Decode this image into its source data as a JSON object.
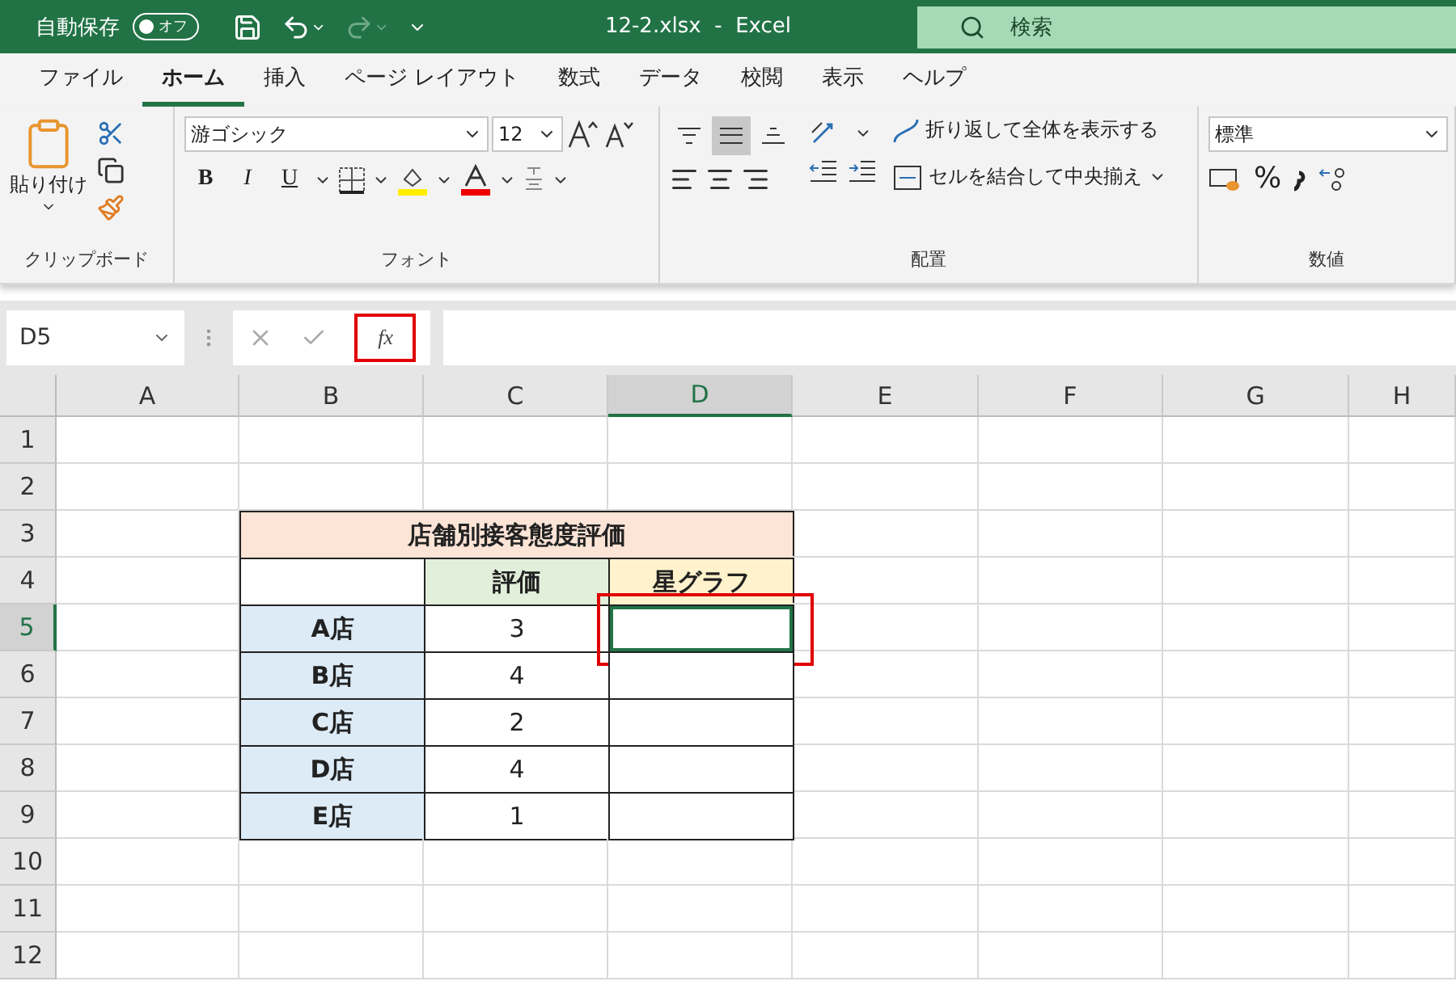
{
  "title_bar": {
    "autosave_label": "自動保存",
    "autosave_toggle": {
      "on": false,
      "label": "オフ"
    },
    "title": "12-2.xlsx  -  Excel",
    "search": {
      "placeholder": "検索"
    }
  },
  "tabs": [
    {
      "label": "ファイル",
      "selected": false
    },
    {
      "label": "ホーム",
      "selected": true
    },
    {
      "label": "挿入",
      "selected": false
    },
    {
      "label": "ページ レイアウト",
      "selected": false
    },
    {
      "label": "数式",
      "selected": false
    },
    {
      "label": "データ",
      "selected": false
    },
    {
      "label": "校閲",
      "selected": false
    },
    {
      "label": "表示",
      "selected": false
    },
    {
      "label": "ヘルプ",
      "selected": false
    }
  ],
  "ribbon": {
    "clipboard": {
      "paste_label": "貼り付け",
      "group_label": "クリップボード"
    },
    "font": {
      "font_name": "游ゴシック",
      "font_size": "12",
      "bold": "B",
      "italic": "I",
      "underline": "U",
      "group_label": "フォント"
    },
    "alignment": {
      "vertical_align": [
        {
          "selected": false
        },
        {
          "selected": true
        },
        {
          "selected": false
        }
      ],
      "wrap_text": "折り返して全体を表示する",
      "merge_center": "セルを結合して中央揃え",
      "group_label": "配置"
    },
    "number": {
      "format": "標準",
      "percent": "%",
      "group_label": "数値"
    }
  },
  "formula_bar": {
    "name_box": "D5",
    "function_label": "fx",
    "function_highlighted": true
  },
  "sheet": {
    "columns": [
      {
        "label": "A",
        "selected": false
      },
      {
        "label": "B",
        "selected": false
      },
      {
        "label": "C",
        "selected": false
      },
      {
        "label": "D",
        "selected": true
      },
      {
        "label": "E",
        "selected": false
      },
      {
        "label": "F",
        "selected": false
      },
      {
        "label": "G",
        "selected": false
      },
      {
        "label": "H",
        "selected": false
      }
    ],
    "rows": [
      {
        "label": "1",
        "selected": false
      },
      {
        "label": "2",
        "selected": false
      },
      {
        "label": "3",
        "selected": false
      },
      {
        "label": "4",
        "selected": false
      },
      {
        "label": "5",
        "selected": true
      },
      {
        "label": "6",
        "selected": false
      },
      {
        "label": "7",
        "selected": false
      },
      {
        "label": "8",
        "selected": false
      },
      {
        "label": "9",
        "selected": false
      },
      {
        "label": "10",
        "selected": false
      },
      {
        "label": "11",
        "selected": false
      },
      {
        "label": "12",
        "selected": false
      }
    ],
    "table": {
      "title": {
        "text": "店舗別接客態度評価",
        "color": "#fce4d6"
      },
      "headers": [
        {
          "text": "評価",
          "color": "#e2efda"
        },
        {
          "text": "星グラフ",
          "color": "#fff2cc"
        }
      ],
      "rows": [
        {
          "store": "A店",
          "rating": "3",
          "selected": true
        },
        {
          "store": "B店",
          "rating": "4",
          "selected": false
        },
        {
          "store": "C店",
          "rating": "2",
          "selected": false
        },
        {
          "store": "D店",
          "rating": "4",
          "selected": false
        },
        {
          "store": "E店",
          "rating": "1",
          "selected": false
        }
      ]
    }
  }
}
